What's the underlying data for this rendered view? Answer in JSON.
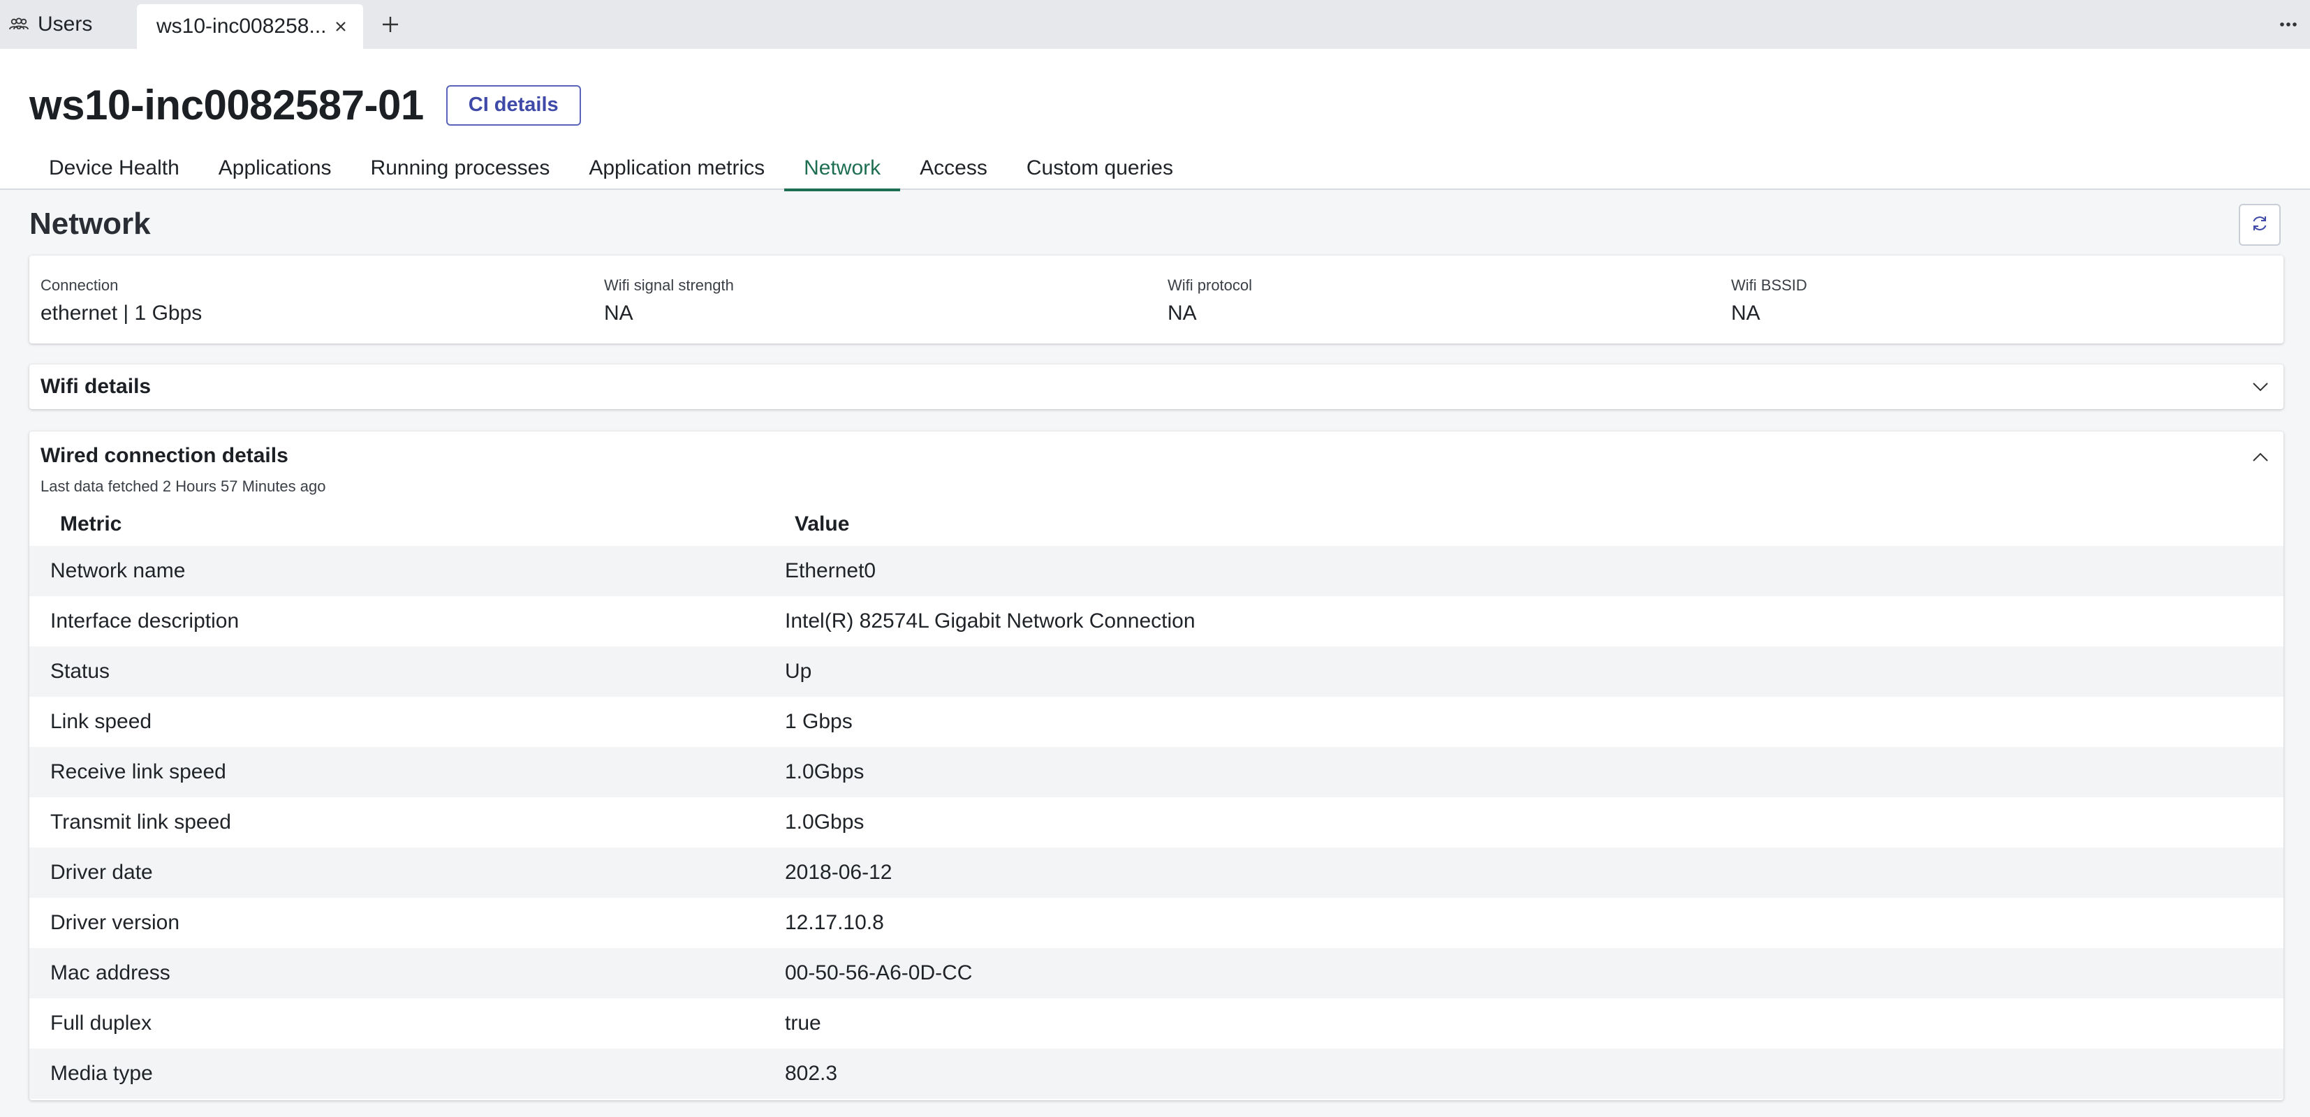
{
  "tabstrip": {
    "users_label": "Users",
    "active_tab_label": "ws10-inc008258..."
  },
  "header": {
    "title": "ws10-inc0082587-01",
    "ci_button_label": "CI details",
    "tabs": [
      {
        "label": "Device Health",
        "active": false
      },
      {
        "label": "Applications",
        "active": false
      },
      {
        "label": "Running processes",
        "active": false
      },
      {
        "label": "Application metrics",
        "active": false
      },
      {
        "label": "Network",
        "active": true
      },
      {
        "label": "Access",
        "active": false
      },
      {
        "label": "Custom queries",
        "active": false
      }
    ]
  },
  "main": {
    "section_title": "Network",
    "summary": [
      {
        "label": "Connection",
        "value": "ethernet | 1 Gbps"
      },
      {
        "label": "Wifi signal strength",
        "value": "NA"
      },
      {
        "label": "Wifi protocol",
        "value": "NA"
      },
      {
        "label": "Wifi BSSID",
        "value": "NA"
      }
    ],
    "wifi_details": {
      "title": "Wifi details",
      "expanded": false
    },
    "wired_details": {
      "title": "Wired connection details",
      "expanded": true,
      "fetched_text": "Last data fetched 2 Hours 57 Minutes ago",
      "columns": {
        "metric": "Metric",
        "value": "Value"
      },
      "rows": [
        {
          "metric": "Network name",
          "value": "Ethernet0"
        },
        {
          "metric": "Interface description",
          "value": "Intel(R) 82574L Gigabit Network Connection"
        },
        {
          "metric": "Status",
          "value": "Up"
        },
        {
          "metric": "Link speed",
          "value": "1 Gbps"
        },
        {
          "metric": "Receive link speed",
          "value": "1.0Gbps"
        },
        {
          "metric": "Transmit link speed",
          "value": "1.0Gbps"
        },
        {
          "metric": "Driver date",
          "value": "2018-06-12"
        },
        {
          "metric": "Driver version",
          "value": "12.17.10.8"
        },
        {
          "metric": "Mac address",
          "value": "00-50-56-A6-0D-CC"
        },
        {
          "metric": "Full duplex",
          "value": "true"
        },
        {
          "metric": "Media type",
          "value": "802.3"
        }
      ]
    }
  },
  "colors": {
    "accent_active_tab": "#1e6f52",
    "ci_button": "#3f4aa8",
    "page_background": "#f5f6f8"
  },
  "icons": {
    "users": "users-icon",
    "close": "close-icon",
    "add": "plus-icon",
    "more": "more-horizontal-icon",
    "refresh": "refresh-icon",
    "collapsed": "chevron-down-icon",
    "expanded": "chevron-up-icon"
  }
}
